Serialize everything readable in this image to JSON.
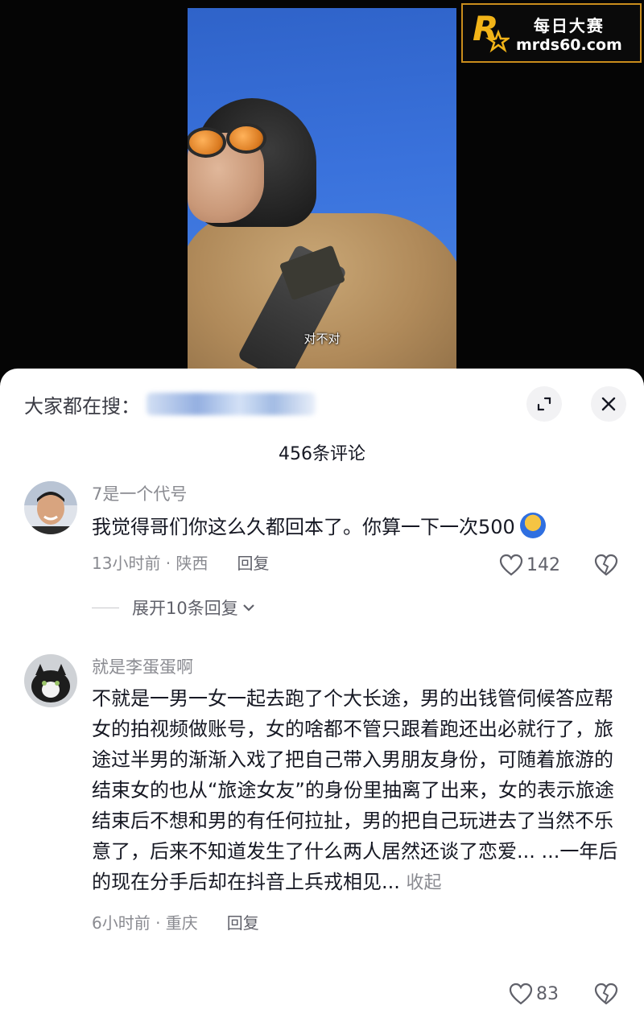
{
  "video": {
    "subtitle": "对不对"
  },
  "watermark": {
    "line1": "每日大赛",
    "line2": "mrds60.com",
    "mark_letter": "R",
    "mark_small": "每日大赛"
  },
  "sheet": {
    "search_label": "大家都在搜：",
    "comment_count": "456条评论"
  },
  "comments": [
    {
      "user": "7是一个代号",
      "text": "我觉得哥们你这么久都回本了。你算一下一次500",
      "time_location": "13小时前 · 陕西",
      "reply_label": "回复",
      "likes": "142",
      "expand_label": "展开10条回复"
    },
    {
      "user": "就是李蛋蛋啊",
      "text": "不就是一男一女一起去跑了个大长途，男的出钱管伺候答应帮女的拍视频做账号，女的啥都不管只跟着跑还出必就行了，旅途过半男的渐渐入戏了把自己带入男朋友身份，可随着旅游的结束女的也从“旅途女友”的身份里抽离了出来，女的表示旅途结束后不想和男的有任何拉扯，男的把自己玩进去了当然不乐意了，后来不知道发生了什么两人居然还谈了恋爱... ...一年后的现在分手后却在抖音上兵戎相见...",
      "collapse_label": "收起",
      "time_location": "6小时前 · 重庆",
      "reply_label": "回复",
      "likes": "83"
    }
  ],
  "colors": {
    "sky": "#3a72dc",
    "sheet_bg": "#ffffff",
    "meta_gray": "#8a8b91",
    "logo_border": "#c98d1c"
  }
}
